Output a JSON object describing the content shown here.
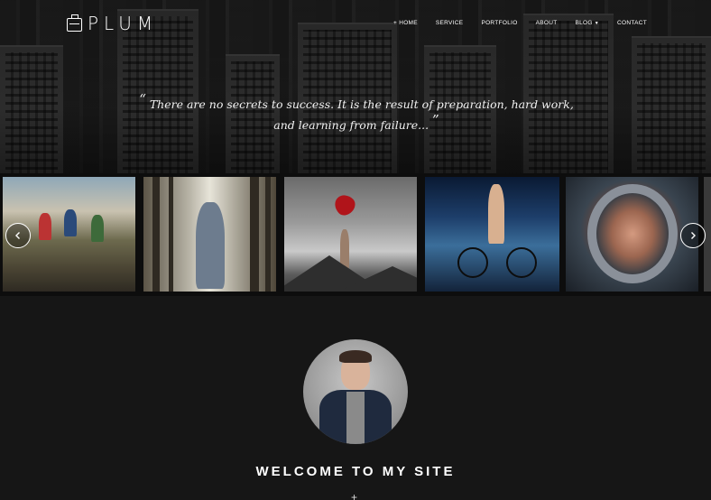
{
  "brand": {
    "name": "PLUM",
    "icon": "briefcase-icon"
  },
  "nav": {
    "items": [
      {
        "label": "+ HOME",
        "active": true
      },
      {
        "label": "SERVICE"
      },
      {
        "label": "PORTFOLIO"
      },
      {
        "label": "ABOUT"
      },
      {
        "label": "BLOG",
        "has_dropdown": true
      },
      {
        "label": "CONTACT"
      }
    ]
  },
  "hero": {
    "quote_open": "“",
    "quote": "There are no secrets to success. It is the result of preparation, hard work, and learning from failure...",
    "quote_close": "”"
  },
  "gallery": {
    "images": [
      "mountain-bikers-photo",
      "boy-in-forest-photo",
      "girl-with-balloon-photo",
      "cyclist-at-night-photo",
      "astronaut-photo"
    ],
    "prev_icon": "chevron-left-icon",
    "next_icon": "chevron-right-icon"
  },
  "about": {
    "heading": "WELCOME TO MY SITE",
    "divider": "+"
  },
  "colors": {
    "background": "#161616",
    "text": "#ffffff"
  }
}
